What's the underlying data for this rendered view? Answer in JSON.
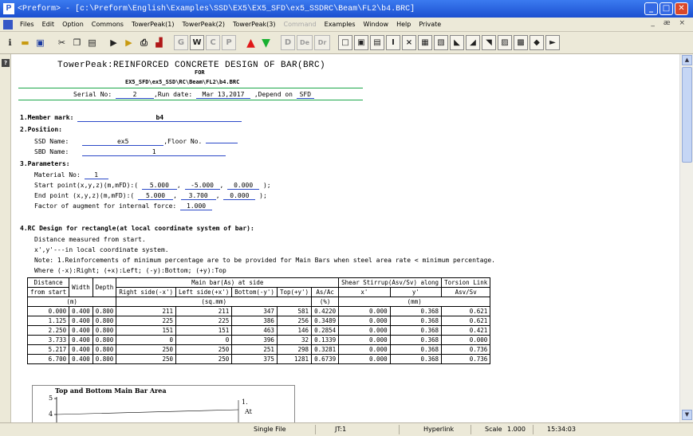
{
  "window": {
    "title": "<Preform> - [c:\\Preform\\English\\Examples\\SSD\\EX5\\EX5_SFD\\ex5_SSDRC\\Beam\\FL2\\b4.BRC]"
  },
  "menu": {
    "items": [
      "Files",
      "Edit",
      "Option",
      "Commons",
      "TowerPeak(1)",
      "TowerPeak(2)",
      "TowerPeak(3)",
      "Command",
      "Examples",
      "Window",
      "Help",
      "Private"
    ],
    "disabled_item": "Command",
    "mdi_buttons": "_ æ ×"
  },
  "toolbar": {
    "letter_buttons": [
      "G",
      "W",
      "C",
      "P"
    ],
    "disabled_letters": [
      "D",
      "De",
      "Dr"
    ],
    "right_glyphs": [
      "□",
      "▣",
      "▤",
      "I",
      "×",
      "▦",
      "▧",
      "◣",
      "◢",
      "◥",
      "▨",
      "▩",
      "◆",
      "►"
    ]
  },
  "document": {
    "title": "TowerPeak:REINFORCED CONCRETE DESIGN OF BAR(BRC)",
    "for_label": "FOR",
    "path": "EX5_SFD\\ex5_SSD\\RC\\Beam\\FL2\\b4.BRC",
    "serial": {
      "label": "Serial No:",
      "value": "2",
      "run_label": ",Run date:",
      "run_date": "Mar 13,2017",
      "depend_label": ",Depend on",
      "depend_value": "SFD"
    },
    "member": {
      "label": "1.Member mark:",
      "value": "b4"
    },
    "position": {
      "label": "2.Position:",
      "ssd_label": "SSD Name:",
      "ssd_value": "ex5",
      "floor_label": ",Floor No.",
      "floor_value": "",
      "sbd_label": "SBD Name:",
      "sbd_value": "1"
    },
    "parameters": {
      "label": "3.Parameters:",
      "material_label": "Material No:",
      "material_value": "1",
      "start_label": "Start point(x,y,z)(m,mFD):(",
      "start_values": [
        "5.000",
        "-5.000",
        "0.000"
      ],
      "end_label": "End point  (x,y,z)(m,mFD):(",
      "end_values": [
        "5.000",
        "3.700",
        "0.000"
      ],
      "close": ");",
      "factor_label": "Factor of augment for internal force:",
      "factor_value": "1.000"
    },
    "rc_design": {
      "label": "4.RC Design for rectangle(at local coordinate system of bar):",
      "line1": "Distance measured from start.",
      "line2": "x',y'---in local coordinate system.",
      "line3": "Note: 1.Reinforcements of minimum percentage are to be provided for Main Bars when steel area rate < minimum percentage.",
      "line4": "Where (-x):Right; (+x):Left; (-y):Bottom; (+y):Top"
    },
    "table": {
      "h_distance": [
        "Distance",
        "from start"
      ],
      "h_width": "Width",
      "h_depth": "Depth",
      "h_main": "Main bar(As) at side",
      "h_right": "Right side(-x')",
      "h_left": "Left side(+x')",
      "h_bottom": "Bottom(-y')",
      "h_top": "Top(+y')",
      "h_asac": "As/Ac",
      "h_shear": "Shear Stirrup(Asv/Sv) along",
      "h_xp": "x'",
      "h_yp": "y'",
      "h_torsion": [
        "Torsion Link",
        "Asv/Sv"
      ],
      "u_m": "(m)",
      "u_sqmm": "(sq.mm)",
      "u_pct": "(%)",
      "u_mm": "(mm)",
      "rows": [
        [
          "0.000",
          "0.400",
          "0.800",
          "211",
          "211",
          "347",
          "581",
          "0.4220",
          "0.000",
          "0.368",
          "0.621"
        ],
        [
          "1.125",
          "0.400",
          "0.800",
          "225",
          "225",
          "386",
          "256",
          "0.3489",
          "0.000",
          "0.368",
          "0.621"
        ],
        [
          "2.250",
          "0.400",
          "0.800",
          "151",
          "151",
          "463",
          "146",
          "0.2854",
          "0.000",
          "0.368",
          "0.421"
        ],
        [
          "3.733",
          "0.400",
          "0.800",
          "0",
          "0",
          "396",
          "32",
          "0.1339",
          "0.000",
          "0.368",
          "0.000"
        ],
        [
          "5.217",
          "0.400",
          "0.800",
          "250",
          "250",
          "251",
          "298",
          "0.3281",
          "0.000",
          "0.368",
          "0.736"
        ],
        [
          "6.700",
          "0.400",
          "0.800",
          "250",
          "250",
          "375",
          "1281",
          "0.6739",
          "0.000",
          "0.368",
          "0.736"
        ]
      ]
    },
    "mini_chart": {
      "title": "Top and Bottom Main Bar Area",
      "ticks": [
        "5",
        "4"
      ],
      "annotation_a": "1.",
      "annotation_b": "At"
    }
  },
  "status": {
    "mode": "Single File",
    "page": "JT:1",
    "hyperlink": "Hyperlink",
    "scale_label": "Scale",
    "scale_value": "1.000",
    "time": "15:34:03"
  }
}
